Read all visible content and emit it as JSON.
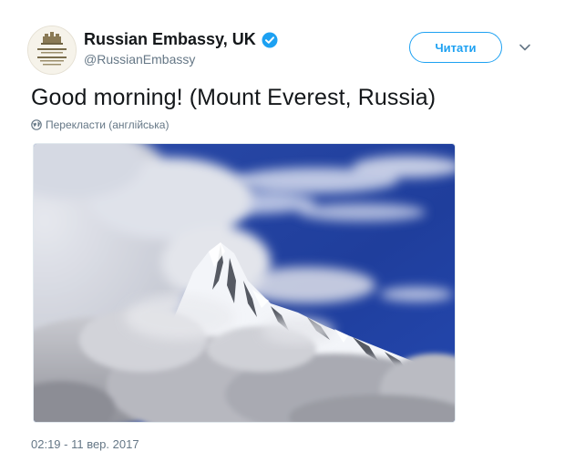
{
  "account": {
    "display_name": "Russian Embassy, UK",
    "handle": "@RussianEmbassy",
    "verified": true
  },
  "header": {
    "follow_label": "Читати",
    "menu_icon": "chevron-down-icon"
  },
  "tweet": {
    "text": "Good morning! (Mount Everest, Russia)",
    "translate_label": "Перекласти (англійська)",
    "translate_icon": "globe-icon",
    "timestamp": "02:19 - 11 вер. 2017"
  },
  "colors": {
    "accent": "#1da1f2",
    "secondary_text": "#657786",
    "primary_text": "#14171a",
    "sky": "#1e3f9a"
  }
}
